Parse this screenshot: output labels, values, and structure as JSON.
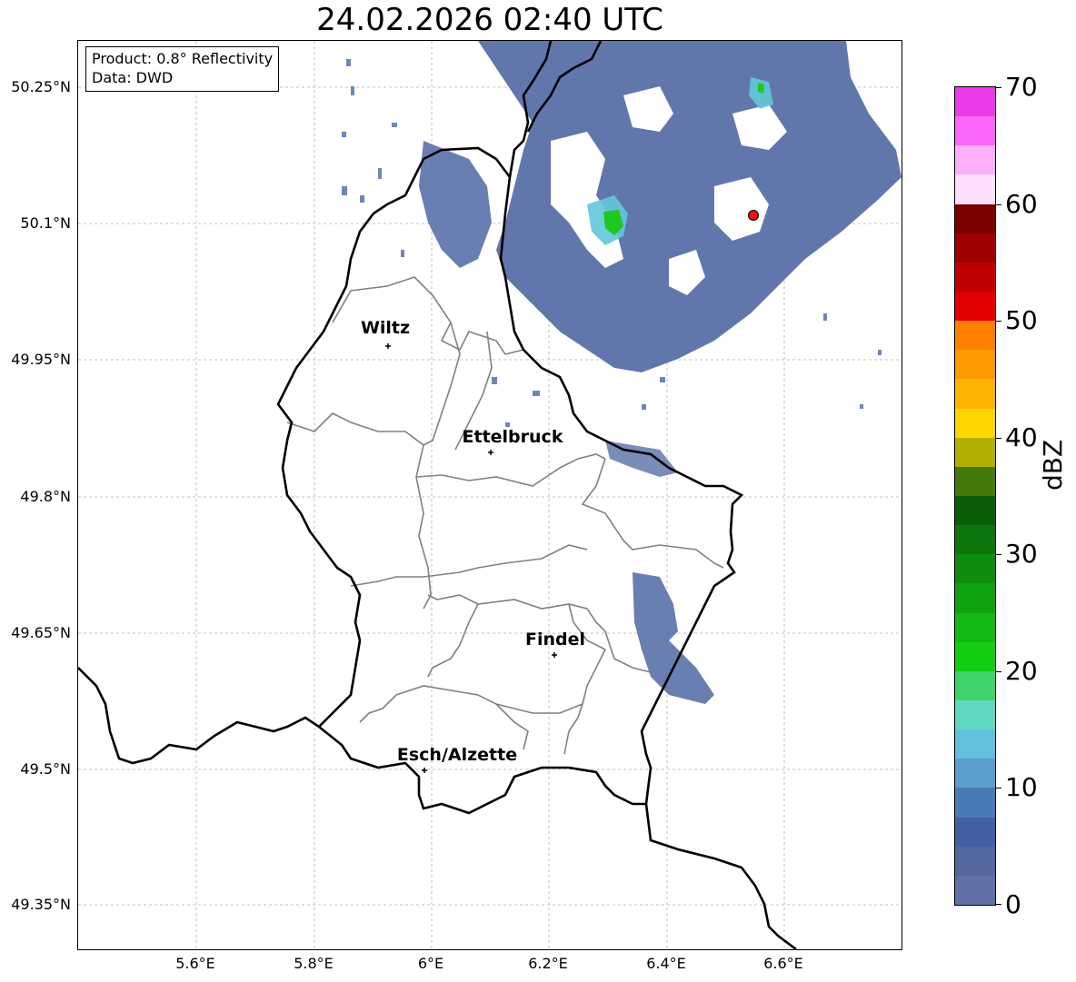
{
  "title": "24.02.2026 02:40 UTC",
  "info": {
    "product": "Product: 0.8° Reflectivity",
    "data": "Data: DWD"
  },
  "axes": {
    "lat_ticks": [
      "50.25°N",
      "50.1°N",
      "49.95°N",
      "49.8°N",
      "49.65°N",
      "49.5°N",
      "49.35°N"
    ],
    "lon_ticks": [
      "5.6°E",
      "5.8°E",
      "6°E",
      "6.2°E",
      "6.4°E",
      "6.6°E"
    ],
    "gridlines": true
  },
  "cities": [
    {
      "name": "Wiltz"
    },
    {
      "name": "Ettelbruck"
    },
    {
      "name": "Findel"
    },
    {
      "name": "Esch/Alzette"
    }
  ],
  "radar_site": {
    "color": "#ee1111"
  },
  "colorbar": {
    "unit": "dBZ",
    "tick_labels": [
      "70",
      "60",
      "50",
      "40",
      "30",
      "20",
      "10",
      "0"
    ],
    "colors_top_to_bottom": [
      "#ea3aea",
      "#fb66fb",
      "#fcb0fb",
      "#fde0fd",
      "#7b0000",
      "#9e0000",
      "#c00000",
      "#e20000",
      "#ff7f00",
      "#ff9a00",
      "#ffb500",
      "#ffd500",
      "#b0b000",
      "#44790b",
      "#0a5e0a",
      "#0c750c",
      "#0e8c0e",
      "#10a210",
      "#13b913",
      "#13cd13",
      "#3fd46b",
      "#60d8c0",
      "#63c0dc",
      "#5aa0cc",
      "#4b7bb7",
      "#4460a5",
      "#54679f",
      "#6270a8"
    ]
  },
  "colors": {
    "border": "#000000",
    "canton_lines": "#808080",
    "echo_main": "#5970a8",
    "echo_dark": "#4b60a0",
    "echo_cyan": "#63c6d8",
    "echo_green": "#1ec81e"
  }
}
